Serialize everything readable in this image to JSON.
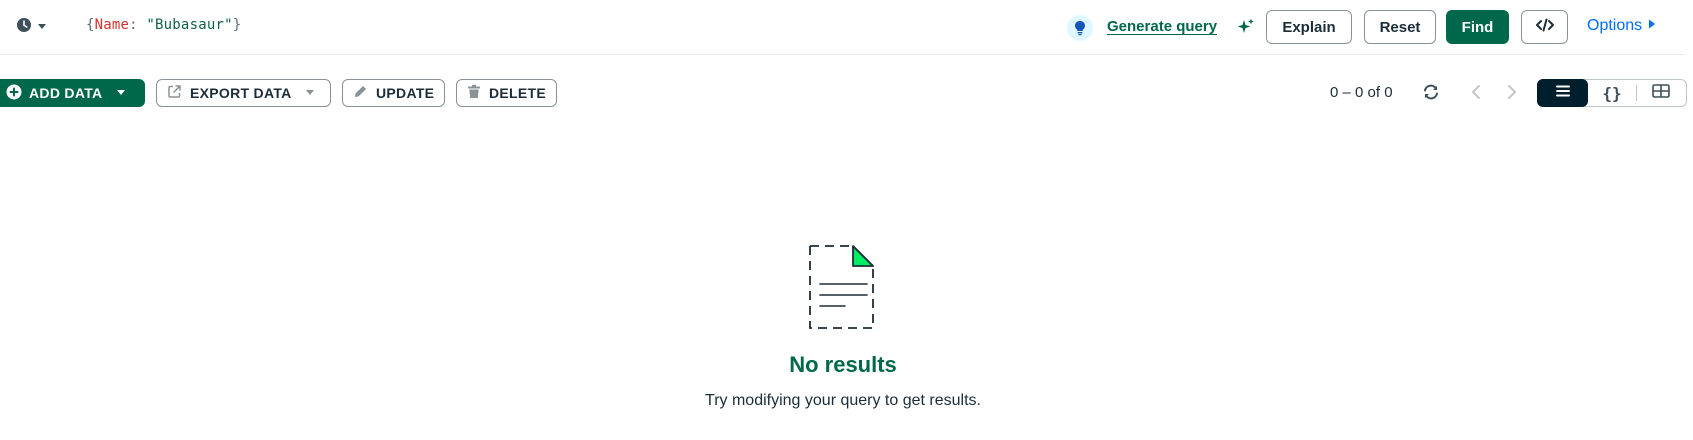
{
  "query_bar": {
    "history_icon": "clock-icon",
    "query": {
      "open": "{",
      "key": "Name",
      "colon": ": ",
      "value": "\"Bubasaur\"",
      "close": "}"
    },
    "ai_icon": "lightbulb-icon",
    "generate_label": "Generate query",
    "sparkle_icon": "sparkle-icon",
    "explain_label": "Explain",
    "reset_label": "Reset",
    "find_label": "Find",
    "code_icon": "code-icon",
    "options_label": "Options"
  },
  "toolbar": {
    "add_data_label": "ADD DATA",
    "export_label": "EXPORT DATA",
    "update_label": "UPDATE",
    "delete_label": "DELETE",
    "pagination_text": "0 – 0 of 0",
    "views": [
      "list-view",
      "json-view",
      "table-view"
    ],
    "active_view": "list-view"
  },
  "empty_state": {
    "title": "No results",
    "subtitle": "Try modifying your query to get results."
  },
  "colors": {
    "brand_green": "#00684a",
    "link_blue": "#016bf8",
    "dark": "#001e2b",
    "key_red": "#db3030"
  }
}
